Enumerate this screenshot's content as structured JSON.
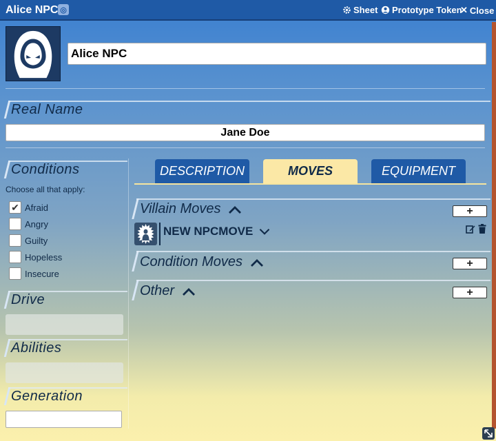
{
  "window": {
    "title": "Alice NPC",
    "globe_icon": "globe-icon",
    "sheet_label": "Sheet",
    "prototype_label": "Prototype Token",
    "close_label": "Close"
  },
  "header": {
    "name_value": "Alice NPC",
    "portrait_icon": "hooded-figure-icon"
  },
  "real_name": {
    "label": "Real Name",
    "value": "Jane Doe"
  },
  "conditions": {
    "label": "Conditions",
    "hint": "Choose all that apply:",
    "items": [
      {
        "label": "Afraid",
        "checked": true
      },
      {
        "label": "Angry",
        "checked": false
      },
      {
        "label": "Guilty",
        "checked": false
      },
      {
        "label": "Hopeless",
        "checked": false
      },
      {
        "label": "Insecure",
        "checked": false
      }
    ]
  },
  "drive": {
    "label": "Drive",
    "value": ""
  },
  "abilities": {
    "label": "Abilities",
    "value": ""
  },
  "generation": {
    "label": "Generation",
    "value": ""
  },
  "tabs": [
    {
      "label": "DESCRIPTION",
      "active": false
    },
    {
      "label": "MOVES",
      "active": true
    },
    {
      "label": "EQUIPMENT",
      "active": false
    }
  ],
  "moves": {
    "groups": [
      {
        "label": "Villain Moves",
        "add_label": "+"
      },
      {
        "label": "Condition Moves",
        "add_label": "+"
      },
      {
        "label": "Other",
        "add_label": "+"
      }
    ],
    "items": [
      {
        "name": "NEW NPCMOVE",
        "icon": "villain-move-icon"
      }
    ]
  },
  "colors": {
    "titlebar": "#1f5aa6",
    "tab_active": "#fbe8a6",
    "tab_inactive": "#1f5aa6",
    "text_dark": "#102a48",
    "rail": "#b4542e"
  }
}
